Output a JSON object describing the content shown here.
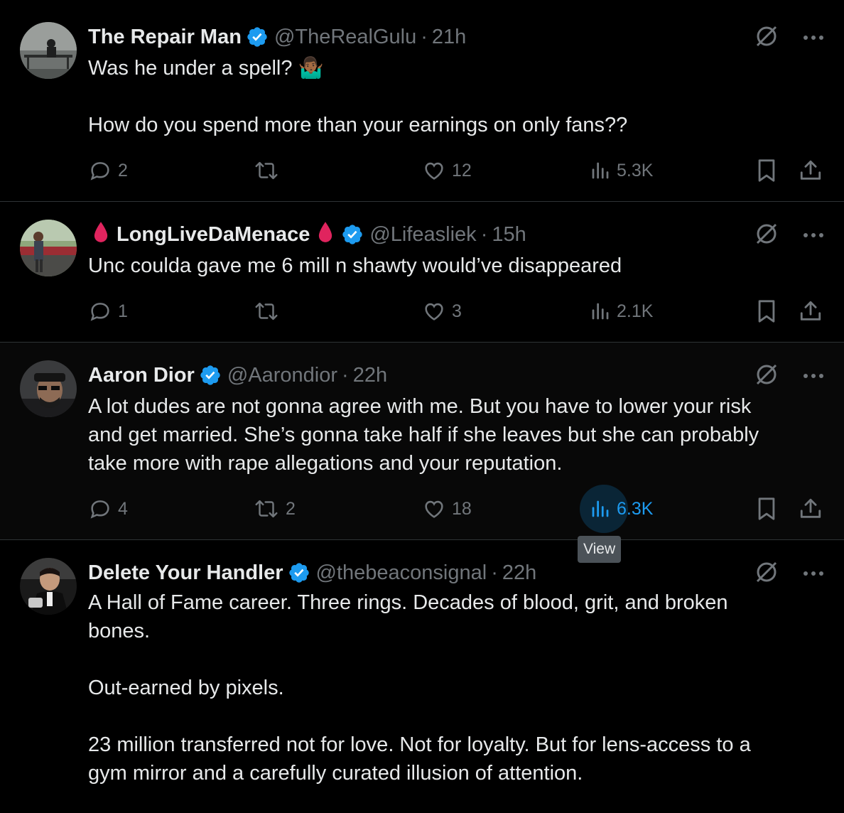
{
  "tweets": [
    {
      "name": "The Repair Man",
      "handle": "@TheRealGulu",
      "dot": "·",
      "time": "21h",
      "lines": [
        "Was he under a spell? 🤷🏾‍♂️",
        "",
        "How do you spend more than your earnings on only fans??"
      ],
      "replies": "2",
      "reposts": "",
      "likes": "12",
      "views": "5.3K"
    },
    {
      "name": "LongLiveDaMenace",
      "handle": "@Lifeasliek",
      "dot": "·",
      "time": "15h",
      "lines": [
        "Unc coulda gave me 6 mill n shawty would’ve disappeared"
      ],
      "replies": "1",
      "reposts": "",
      "likes": "3",
      "views": "2.1K"
    },
    {
      "name": "Aaron Dior",
      "handle": "@Aarondior",
      "dot": "·",
      "time": "22h",
      "lines": [
        "A lot dudes are not gonna agree with me. But you have to lower your risk",
        "and get married. She’s gonna take half if she leaves but she can probably",
        "take more with rape allegations and your reputation."
      ],
      "replies": "4",
      "reposts": "2",
      "likes": "18",
      "views": "6.3K"
    },
    {
      "name": "Delete Your Handler",
      "handle": "@thebeaconsignal",
      "dot": "·",
      "time": "22h",
      "lines": [
        "A Hall of Fame career. Three rings. Decades of blood, grit, and broken",
        "bones.",
        "",
        "Out-earned by pixels.",
        "",
        "23 million transferred not for love. Not for loyalty. But for lens-access to a",
        "gym mirror and a carefully curated illusion of attention."
      ]
    }
  ],
  "tooltip": "View",
  "colors": {
    "background": "#000000",
    "text": "#e7e9ea",
    "muted": "#71767b",
    "accent": "#1d9bf0",
    "divider": "#2f3336",
    "drop": "#e0245e"
  },
  "icons": [
    "verified-badge-icon",
    "grok-icon",
    "more-icon",
    "reply-icon",
    "repost-icon",
    "like-icon",
    "views-icon",
    "bookmark-icon",
    "share-icon",
    "blood-drop-icon"
  ]
}
